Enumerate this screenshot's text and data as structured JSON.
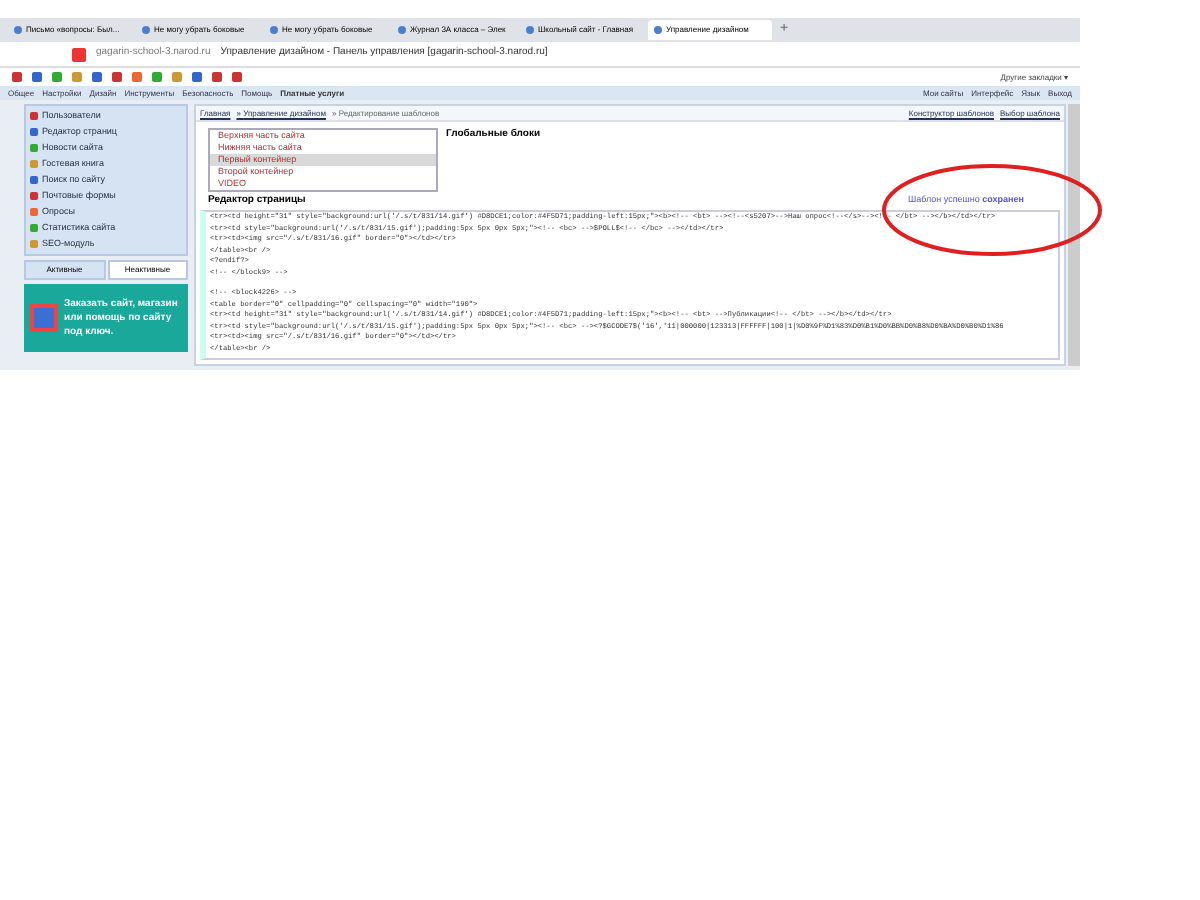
{
  "browser": {
    "tabs": [
      {
        "label": "Письмо «вопросы: Был...",
        "selected": false
      },
      {
        "label": "Не могу убрать боковые",
        "selected": false
      },
      {
        "label": "Не могу убрать боковые",
        "selected": false
      },
      {
        "label": "Журнал 3А класса – Элек",
        "selected": false
      },
      {
        "label": "Школьный сайт - Главная",
        "selected": false
      },
      {
        "label": "Управление дизайном",
        "selected": true
      }
    ],
    "new_tab": "+",
    "domain": "gagarin-school-3.narod.ru",
    "page_title": "Управление дизайном - Панель управления [gagarin-school-3.narod.ru]",
    "other_bookmarks": "Другие закладки ▾"
  },
  "menu": {
    "items": [
      "Общее",
      "Настройки",
      "Дизайн",
      "Инструменты",
      "Безопасность",
      "Помощь"
    ],
    "paid": "Платные услуги",
    "right": [
      "Мои сайты",
      "Интерфейс",
      "Язык",
      "Выход"
    ]
  },
  "sidebar": {
    "items": [
      "Пользователи",
      "Редактор страниц",
      "Новости сайта",
      "Гостевая книга",
      "Поиск по сайту",
      "Почтовые формы",
      "Опросы",
      "Статистика сайта",
      "SEO-модуль"
    ],
    "tabs": [
      {
        "label": "Активные",
        "selected": true
      },
      {
        "label": "Неактивные",
        "selected": false
      }
    ],
    "banner": "Заказать сайт, магазин или помощь по сайту под ключ."
  },
  "breadcrumb": [
    "Главная",
    "Управление дизайном",
    "Редактирование шаблонов"
  ],
  "top_links": [
    "Конструктор шаблонов",
    "Выбор шаблона"
  ],
  "templates": [
    {
      "label": "Верхняя часть сайта",
      "selected": false
    },
    {
      "label": "Нижняя часть сайта",
      "selected": false
    },
    {
      "label": "Первый контейнер",
      "selected": true
    },
    {
      "label": "Второй контейнер",
      "selected": false
    },
    {
      "label": "VIDEO",
      "selected": false
    }
  ],
  "global_blocks": "Глобальные блоки",
  "editor_label": "Редактор страницы",
  "status": "Шаблон успешно **сохранен**",
  "breadcrumb_separator": "»",
  "code": [
    [
      "<tr><td height=\"31\" style=\"background:url('/.s/t/831/14.gif') #D8DCE1;color:#4F5D71;padding-left:15px;\"><b><!-- <bt> --><!--<s5207>-->Наш опрос<!--</s>--><!-- </bt> --></b></td></tr>",
      "<tr><td style=\"background:url('/.s/t/831/15.gif');padding:5px 5px 0px 5px;\"><!-- <bc> -->$POLL$<!-- </bc> --></td></tr>",
      "<tr><td><img src=\"/.s/t/831/16.gif\" border=\"0\"></td></tr>",
      "</table><br />",
      "<?endif?>",
      "<!-- </block9> -->"
    ],
    [
      "<!-- <block4226> -->",
      "<table border=\"0\" cellpadding=\"0\" cellspacing=\"0\" width=\"190\">",
      "<tr><td height=\"31\" style=\"background:url('/.s/t/831/14.gif') #D8DCE1;color:#4F5D71;padding-left:15px;\"><b><!-- <bt> -->Публикации<!-- </bt> --></b></td></tr>",
      "<tr><td style=\"background:url('/.s/t/831/15.gif');padding:5px 5px 0px 5px;\"><!-- <bc> --><?$GCODE7$('16','11|000000|123313|FFFFFF|100|1|%D0%9F%D1%83%D0%B1%D0%BB%D0%B8%D0%BA%D0%B0%D1%86",
      "<tr><td><img src=\"/.s/t/831/16.gif\" border=\"0\"></td></tr>",
      "</table><br />"
    ]
  ]
}
